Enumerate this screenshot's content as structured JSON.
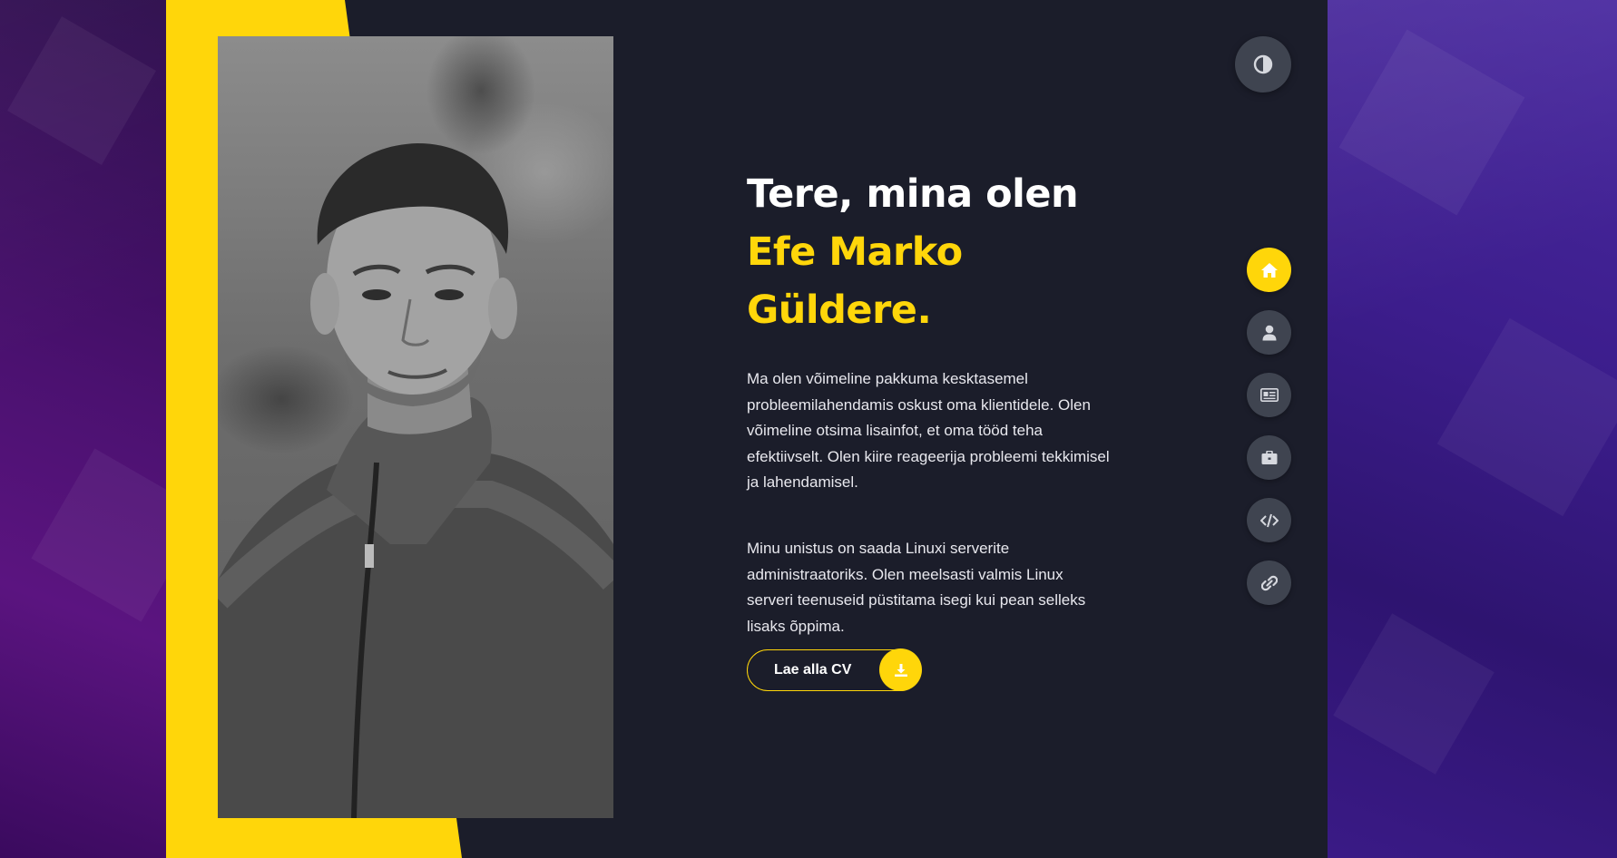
{
  "hero": {
    "greeting": "Tere, mina olen",
    "name_line1": "Efe Marko",
    "name_line2": "Güldere.",
    "paragraph1": "Ma olen võimeline pakkuma kesktasemel probleemilahendamis oskust oma klientidele. Olen võimeline otsima lisainfot, et oma tööd teha efektiivselt. Olen kiire reageerija probleemi tekkimisel ja lahendamisel.",
    "paragraph2": "Minu unistus on saada Linuxi serverite administraatoriks. Olen meelsasti valmis Linux serveri teenuseid püstitama isegi kui pean selleks lisaks õppima.",
    "cv_button_label": "Lae alla CV"
  },
  "nav": {
    "items": [
      {
        "icon": "home-icon",
        "active": true
      },
      {
        "icon": "user-icon",
        "active": false
      },
      {
        "icon": "id-card-icon",
        "active": false
      },
      {
        "icon": "briefcase-icon",
        "active": false
      },
      {
        "icon": "code-icon",
        "active": false
      },
      {
        "icon": "link-icon",
        "active": false
      }
    ]
  },
  "theme_toggle": {
    "icon": "contrast-icon"
  },
  "colors": {
    "accent": "#ffd60a",
    "card_background": "#1b1d2a",
    "nav_button": "#3f4450",
    "text_primary": "#ffffff"
  }
}
